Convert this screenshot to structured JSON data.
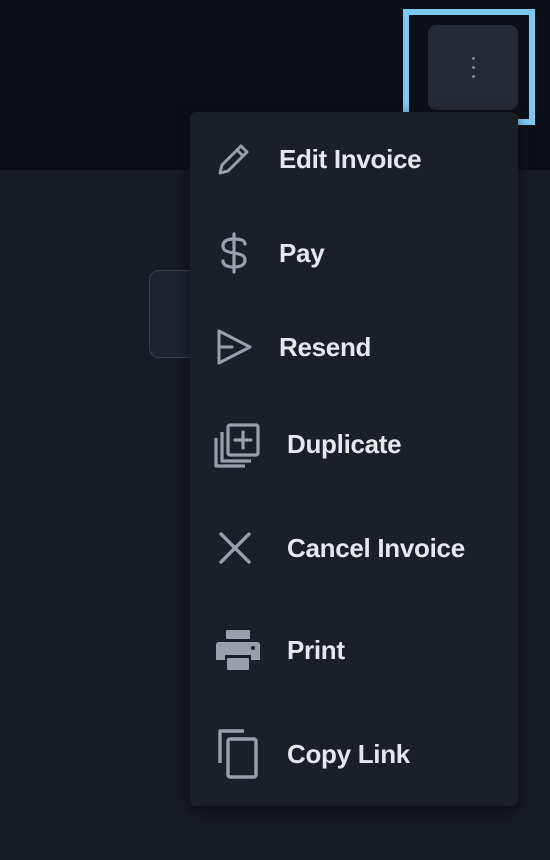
{
  "menu_button": {
    "icon": "kebab-vertical-icon"
  },
  "menu": {
    "items": [
      {
        "label": "Edit Invoice",
        "icon": "pencil-icon"
      },
      {
        "label": "Pay",
        "icon": "dollar-icon"
      },
      {
        "label": "Resend",
        "icon": "send-icon"
      },
      {
        "label": "Duplicate",
        "icon": "duplicate-icon"
      },
      {
        "label": "Cancel Invoice",
        "icon": "close-icon"
      },
      {
        "label": "Print",
        "icon": "printer-icon"
      },
      {
        "label": "Copy Link",
        "icon": "copy-icon"
      }
    ]
  },
  "colors": {
    "highlight": "#7cc8f2",
    "menu_background": "#1b1f26",
    "menu_text": "#e6e8ec",
    "icon": "#9aa0aa"
  }
}
